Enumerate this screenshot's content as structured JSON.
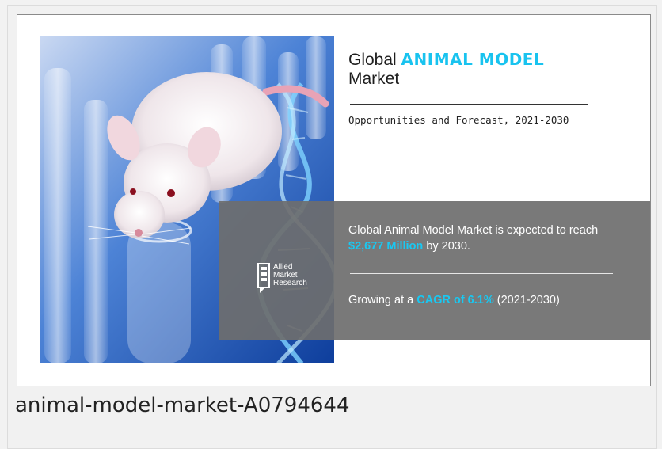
{
  "banner": {
    "title_prefix": "Global",
    "title_accent": "ANIMAL MODEL",
    "title_line2": "Market",
    "subtitle": "Opportunities and Forecast, 2021-2030",
    "stat_text_1": "Global Animal Model Market is expected to reach",
    "stat_value": "$2,677 Million",
    "stat_text_2": "by 2030.",
    "growth_text_1": "Growing at a",
    "growth_value": "CAGR of 6.1%",
    "growth_text_2": "(2021-2030)",
    "logo_lines": [
      "Allied",
      "Market",
      "Research"
    ]
  },
  "caption": "animal-model-market-A0794644",
  "colors": {
    "accent": "#19c3ef",
    "band": "#6e6e6e",
    "photo_blue": "#2f63c0"
  }
}
